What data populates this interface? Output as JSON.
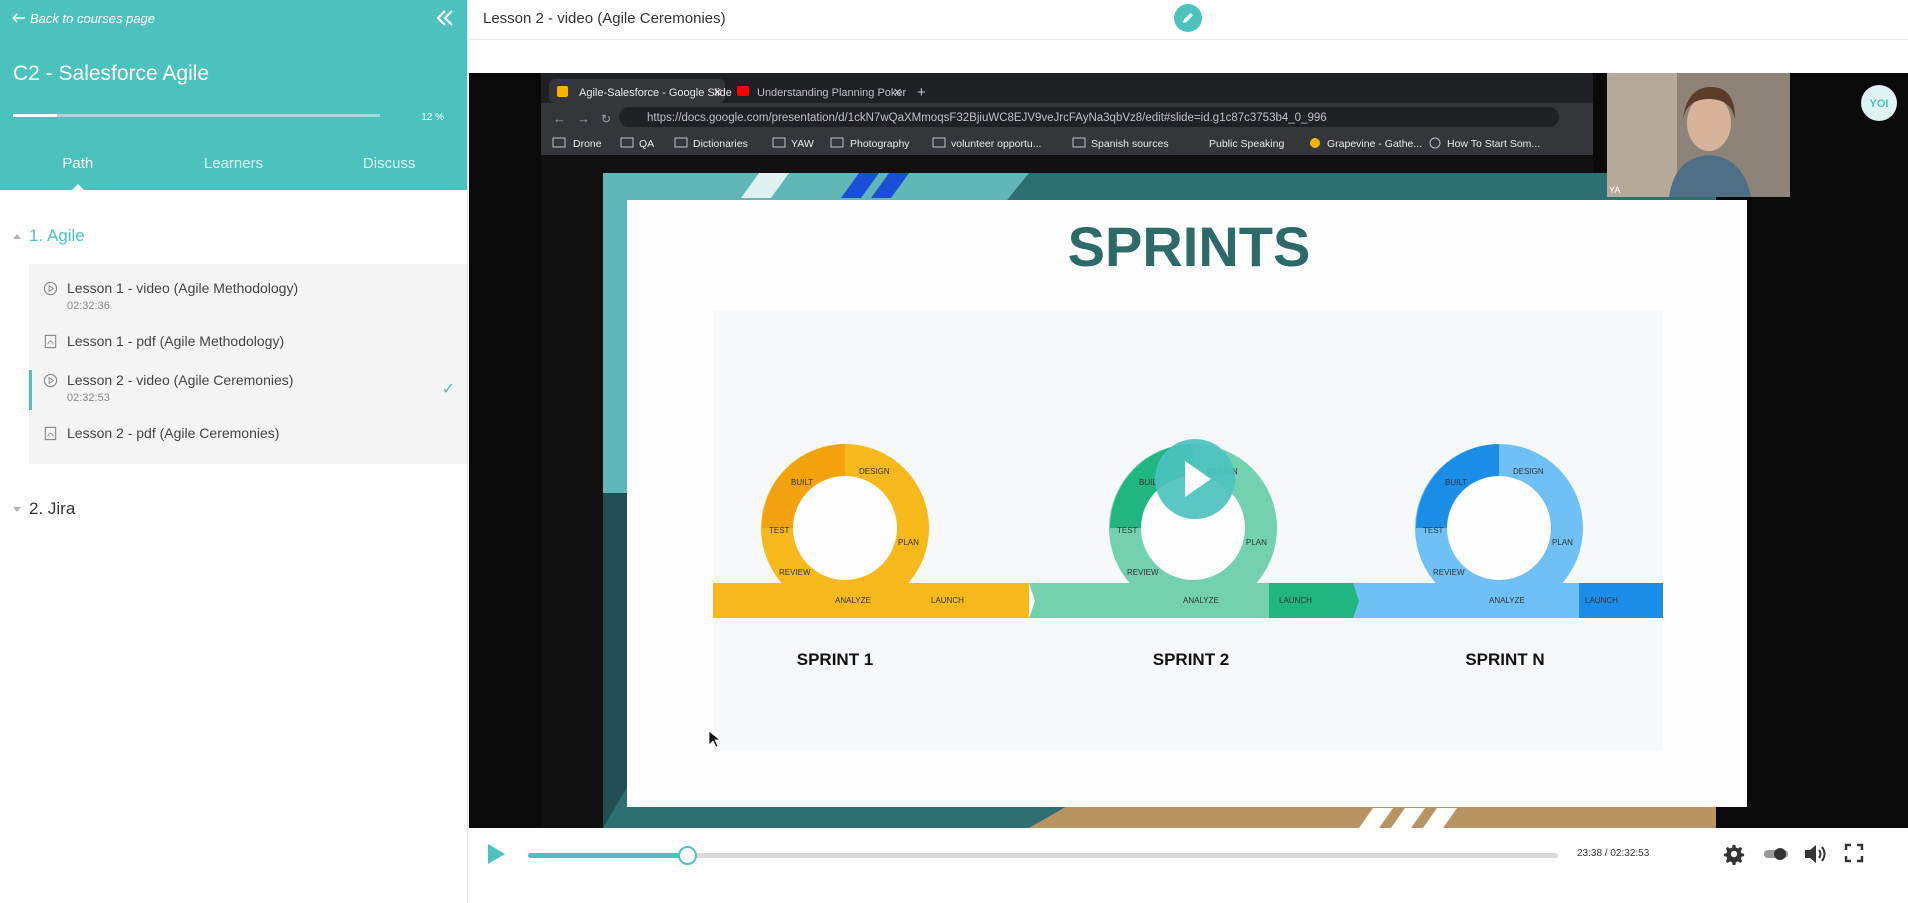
{
  "sidebar": {
    "back_label": "Back to courses page",
    "course_title": "C2 - Salesforce Agile",
    "progress_percent": 12,
    "progress_label": "12 %",
    "tabs": [
      {
        "label": "Path",
        "active": true
      },
      {
        "label": "Learners",
        "active": false
      },
      {
        "label": "Discuss",
        "active": false
      }
    ],
    "sections": [
      {
        "label": "1. Agile",
        "expanded": true,
        "lessons": [
          {
            "icon": "play-circle-icon",
            "title": "Lesson 1 - video (Agile Methodology)",
            "duration": "02:32:36"
          },
          {
            "icon": "pdf-icon",
            "title": "Lesson 1 - pdf (Agile Methodology)",
            "duration": ""
          },
          {
            "icon": "play-circle-icon",
            "title": "Lesson 2 - video (Agile Ceremonies)",
            "duration": "02:32:53",
            "active": true,
            "completed": true
          },
          {
            "icon": "pdf-icon",
            "title": "Lesson 2 - pdf (Agile Ceremonies)",
            "duration": ""
          }
        ]
      },
      {
        "label": "2. Jira",
        "expanded": false
      }
    ]
  },
  "main": {
    "lesson_title": "Lesson 2 - video (Agile Ceremonies)"
  },
  "video_frame": {
    "browser": {
      "tabs": [
        "Agile-Salesforce - Google Slide",
        "Understanding Planning Poker"
      ],
      "url": "https://docs.google.com/presentation/d/1ckN7wQaXMmoqsF32BjiuWC8EJV9veJrcFAyNa3qbVz8/edit#slide=id.g1c87c3753b4_0_996",
      "bookmarks": [
        "Drone",
        "QA",
        "Dictionaries",
        "YAW",
        "Photography",
        "volunteer opportu...",
        "Spanish sources",
        "Public Speaking",
        "Grapevine - Gathe...",
        "How To Start Som..."
      ]
    },
    "slide": {
      "title": "SPRINTS",
      "sprints": [
        "SPRINT 1",
        "SPRINT 2",
        "SPRINT N"
      ],
      "cycle_stages": [
        "DESIGN",
        "BUILT",
        "TEST",
        "PLAN",
        "REVIEW",
        "ANALYZE",
        "LAUNCH"
      ]
    },
    "webcam_label": "YA",
    "logo_text": "YOI"
  },
  "player": {
    "current_time": "23:38",
    "total_time": "02:32:53",
    "time_display": "23:38 / 02:32:53",
    "progress_fraction": 0.154
  },
  "colors": {
    "accent": "#4cc2bf",
    "sprint1": "#f6b81b",
    "sprint2": "#3fbf94",
    "sprintN": "#3aa0ee"
  }
}
